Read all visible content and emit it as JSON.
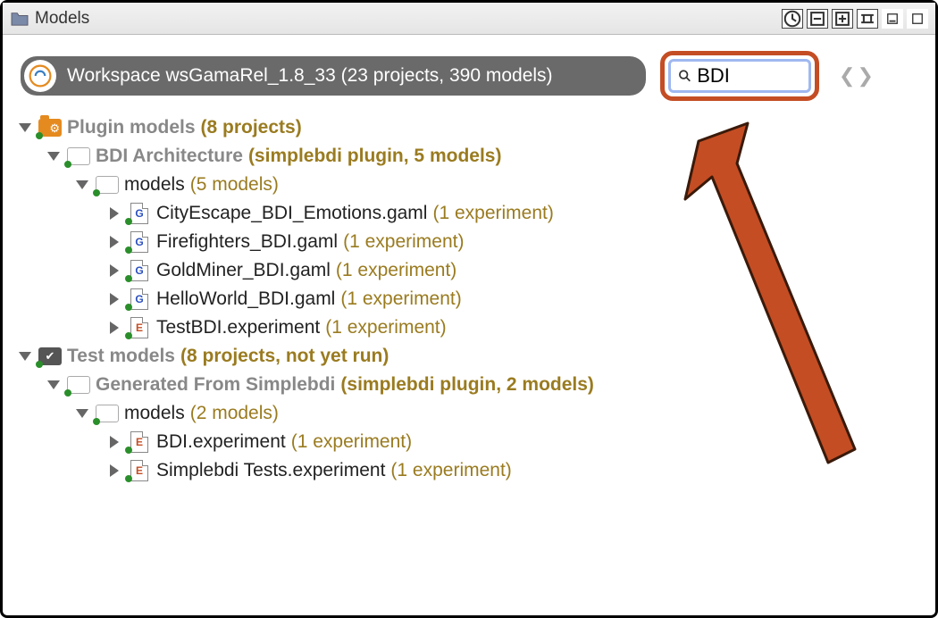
{
  "titlebar": {
    "label": "Models"
  },
  "workspace": {
    "label": "Workspace wsGamaRel_1.8_33 (23 projects, 390 models)"
  },
  "search": {
    "value": "BDI",
    "placeholder": ""
  },
  "tree": {
    "categories": [
      {
        "id": "plugin-models",
        "label": "Plugin models",
        "count": "(8 projects)",
        "iconType": "orange",
        "projects": [
          {
            "id": "bdi-arch",
            "label": "BDI Architecture",
            "meta": "(simplebdi plugin, 5 models)",
            "folders": [
              {
                "id": "models1",
                "label": "models",
                "meta": "(5 models)",
                "files": [
                  {
                    "id": "f1",
                    "type": "g",
                    "label": "CityEscape_BDI_Emotions.gaml",
                    "meta": "(1 experiment)"
                  },
                  {
                    "id": "f2",
                    "type": "g",
                    "label": "Firefighters_BDI.gaml",
                    "meta": "(1 experiment)"
                  },
                  {
                    "id": "f3",
                    "type": "g",
                    "label": "GoldMiner_BDI.gaml",
                    "meta": "(1 experiment)"
                  },
                  {
                    "id": "f4",
                    "type": "g",
                    "label": "HelloWorld_BDI.gaml",
                    "meta": "(1 experiment)"
                  },
                  {
                    "id": "f5",
                    "type": "e",
                    "label": "TestBDI.experiment",
                    "meta": "(1 experiment)"
                  }
                ]
              }
            ]
          }
        ]
      },
      {
        "id": "test-models",
        "label": "Test models",
        "count": "(8 projects, not yet run)",
        "iconType": "check",
        "projects": [
          {
            "id": "gen-simplebdi",
            "label": "Generated From Simplebdi",
            "meta": "(simplebdi plugin, 2 models)",
            "folders": [
              {
                "id": "models2",
                "label": "models",
                "meta": "(2 models)",
                "files": [
                  {
                    "id": "f6",
                    "type": "e",
                    "label": "BDI.experiment",
                    "meta": "(1 experiment)"
                  },
                  {
                    "id": "f7",
                    "type": "e",
                    "label": "Simplebdi Tests.experiment",
                    "meta": "(1 experiment)"
                  }
                ]
              }
            ]
          }
        ]
      }
    ]
  }
}
